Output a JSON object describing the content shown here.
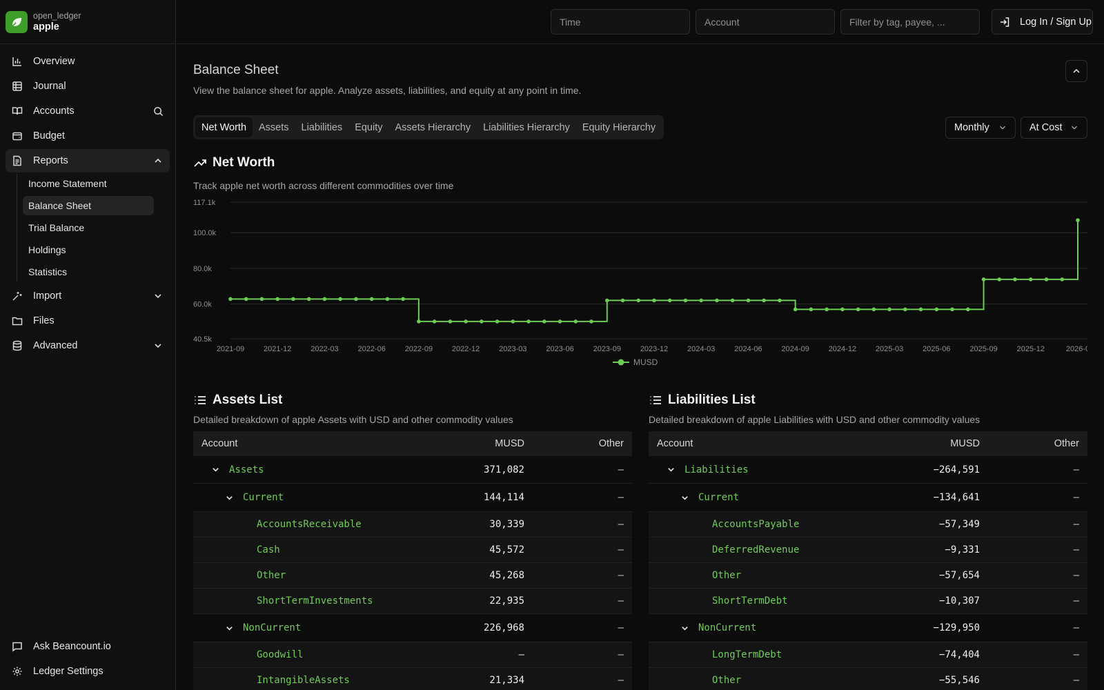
{
  "brand": {
    "org": "open_ledger",
    "name": "apple"
  },
  "nav": {
    "overview": "Overview",
    "journal": "Journal",
    "accounts": "Accounts",
    "budget": "Budget",
    "reports": "Reports",
    "reports_sub": [
      "Income Statement",
      "Balance Sheet",
      "Trial Balance",
      "Holdings",
      "Statistics"
    ],
    "import": "Import",
    "files": "Files",
    "advanced": "Advanced",
    "ask": "Ask Beancount.io",
    "settings": "Ledger Settings"
  },
  "topbar": {
    "time_placeholder": "Time",
    "account_placeholder": "Account",
    "filter_placeholder": "Filter by tag, payee, ...",
    "login_label": "Log In / Sign Up"
  },
  "page": {
    "title": "Balance Sheet",
    "subtitle": "View the balance sheet for apple. Analyze assets, liabilities, and equity at any point in time."
  },
  "tabs": [
    "Net Worth",
    "Assets",
    "Liabilities",
    "Equity",
    "Assets Hierarchy",
    "Liabilities Hierarchy",
    "Equity Hierarchy"
  ],
  "controls": {
    "interval": "Monthly",
    "valuation": "At Cost"
  },
  "net_worth": {
    "title": "Net Worth",
    "subtitle": "Track apple net worth across different commodities over time"
  },
  "chart_data": {
    "type": "line",
    "step": true,
    "title": "",
    "xlabel": "",
    "ylabel": "",
    "ylim": [
      40500,
      117100
    ],
    "y_ticks": [
      "117.1k",
      "100.0k",
      "80.0k",
      "60.0k",
      "40.5k"
    ],
    "x_ticks": [
      "2021-09",
      "2021-12",
      "2022-03",
      "2022-06",
      "2022-09",
      "2022-12",
      "2023-03",
      "2023-06",
      "2023-09",
      "2023-12",
      "2024-03",
      "2024-06",
      "2024-09",
      "2024-12",
      "2025-03",
      "2025-06",
      "2025-09",
      "2025-12",
      "2026-0"
    ],
    "legend": "bottom-center",
    "grid": true,
    "color": "#6ccc56",
    "series": [
      {
        "name": "MUSD",
        "values": [
          62800,
          62800,
          62800,
          62800,
          62800,
          62800,
          62800,
          62800,
          62800,
          62800,
          62800,
          62800,
          50200,
          50200,
          50200,
          50200,
          50200,
          50200,
          50200,
          50200,
          50200,
          50200,
          50200,
          50200,
          62000,
          62000,
          62000,
          62000,
          62000,
          62000,
          62000,
          62000,
          62000,
          62000,
          62000,
          62000,
          57000,
          57000,
          57000,
          57000,
          57000,
          57000,
          57000,
          57000,
          57000,
          57000,
          57000,
          57000,
          73800,
          73800,
          73800,
          73800,
          73800,
          73800,
          107000
        ]
      }
    ]
  },
  "assets": {
    "title": "Assets List",
    "subtitle": "Detailed breakdown of apple Assets with USD and other commodity values",
    "columns": [
      "Account",
      "MUSD",
      "Other"
    ],
    "rows": [
      {
        "name": "Assets",
        "musd": "371,082",
        "other": "–"
      },
      {
        "name": "Current",
        "musd": "144,114",
        "other": "–"
      },
      {
        "name": "AccountsReceivable",
        "musd": "30,339",
        "other": "–"
      },
      {
        "name": "Cash",
        "musd": "45,572",
        "other": "–"
      },
      {
        "name": "Other",
        "musd": "45,268",
        "other": "–"
      },
      {
        "name": "ShortTermInvestments",
        "musd": "22,935",
        "other": "–"
      },
      {
        "name": "NonCurrent",
        "musd": "226,968",
        "other": "–"
      },
      {
        "name": "Goodwill",
        "musd": "–",
        "other": "–"
      },
      {
        "name": "IntangibleAssets",
        "musd": "21,334",
        "other": "–"
      }
    ]
  },
  "liabilities": {
    "title": "Liabilities List",
    "subtitle": "Detailed breakdown of apple Liabilities with USD and other commodity values",
    "columns": [
      "Account",
      "MUSD",
      "Other"
    ],
    "rows": [
      {
        "name": "Liabilities",
        "musd": "−264,591",
        "other": "–"
      },
      {
        "name": "Current",
        "musd": "−134,641",
        "other": "–"
      },
      {
        "name": "AccountsPayable",
        "musd": "−57,349",
        "other": "–"
      },
      {
        "name": "DeferredRevenue",
        "musd": "−9,331",
        "other": "–"
      },
      {
        "name": "Other",
        "musd": "−57,654",
        "other": "–"
      },
      {
        "name": "ShortTermDebt",
        "musd": "−10,307",
        "other": "–"
      },
      {
        "name": "NonCurrent",
        "musd": "−129,950",
        "other": "–"
      },
      {
        "name": "LongTermDebt",
        "musd": "−74,404",
        "other": "–"
      },
      {
        "name": "Other",
        "musd": "−55,546",
        "other": "–"
      }
    ]
  }
}
